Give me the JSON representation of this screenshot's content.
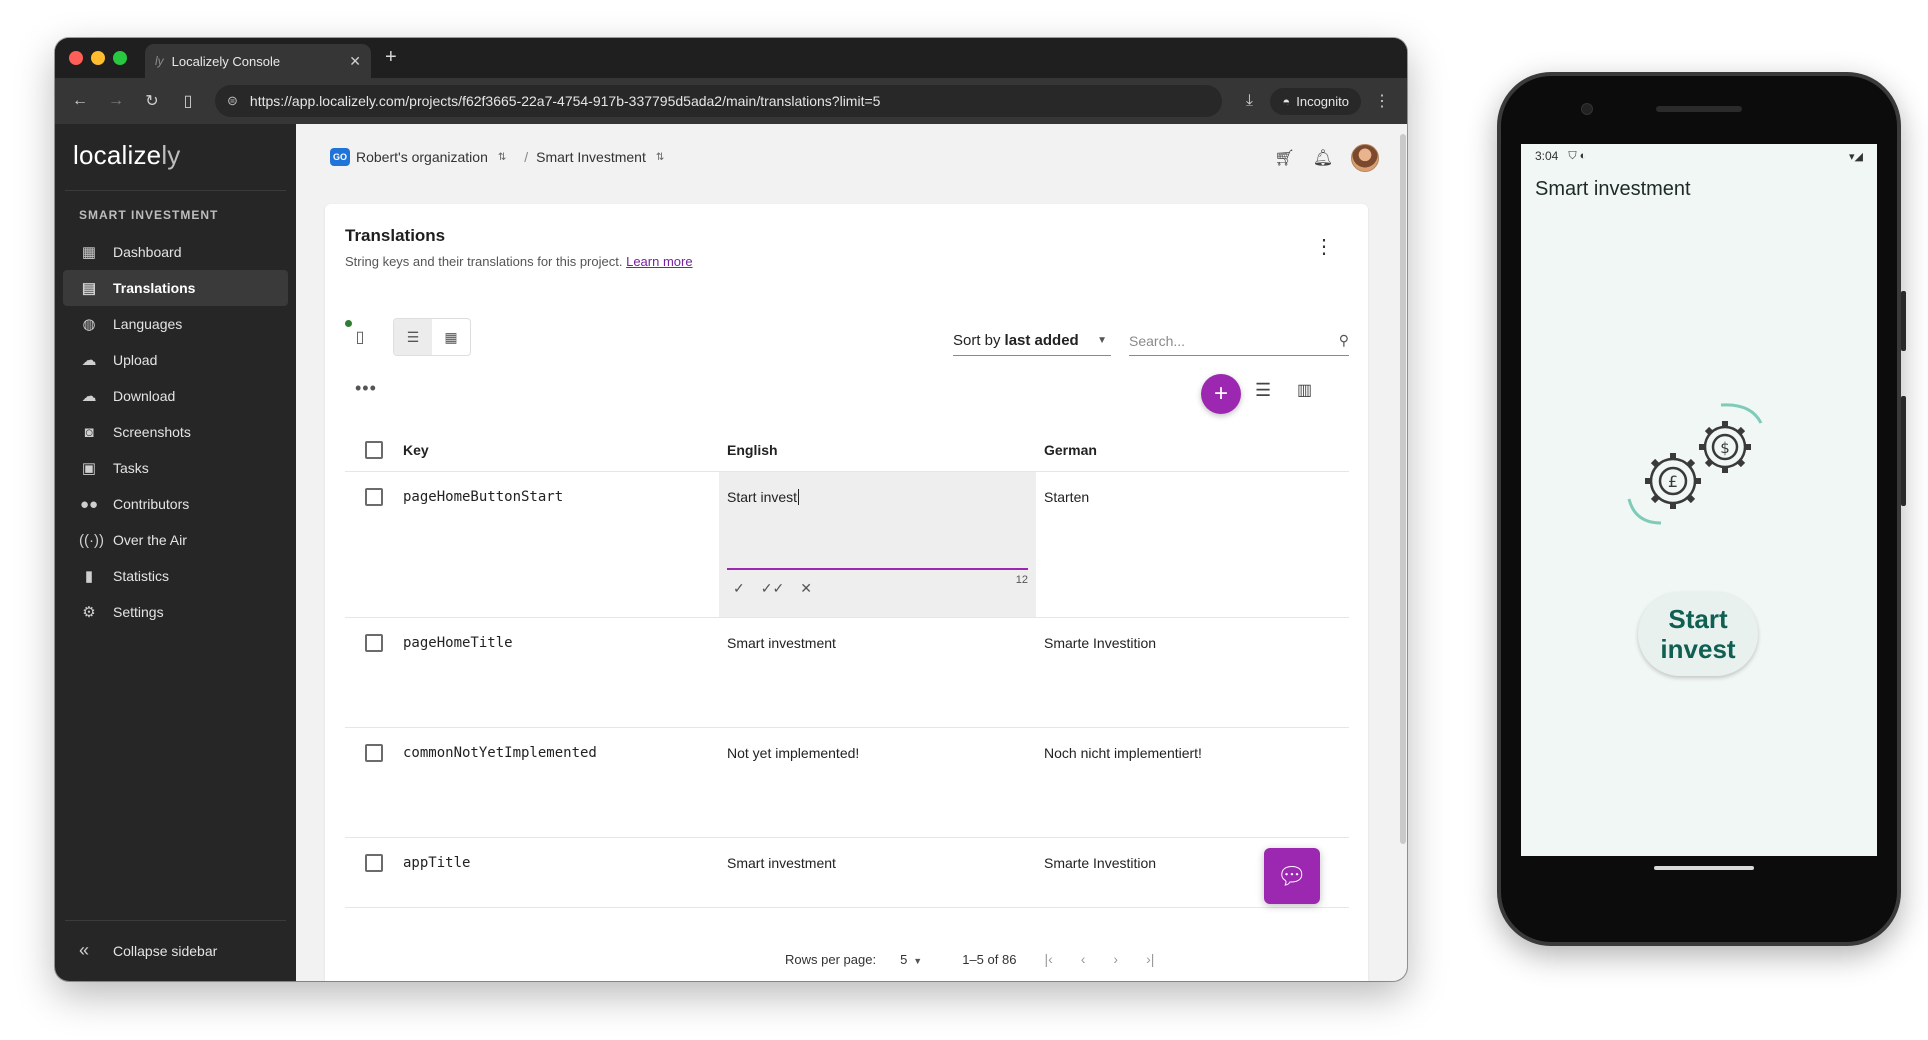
{
  "browser": {
    "tab_title": "Localizely Console",
    "tab_favicon": "ly",
    "url": "https://app.localizely.com/projects/f62f3665-22a7-4754-917b-337795d5ada2/main/translations?limit=5",
    "incognito_label": "Incognito"
  },
  "sidebar": {
    "logo_main": "localize",
    "logo_suffix": "ly",
    "project_name": "SMART INVESTMENT",
    "items": [
      {
        "label": "Dashboard",
        "icon": "dashboard-icon"
      },
      {
        "label": "Translations",
        "icon": "translations-icon",
        "active": true
      },
      {
        "label": "Languages",
        "icon": "globe-icon"
      },
      {
        "label": "Upload",
        "icon": "cloud-upload-icon"
      },
      {
        "label": "Download",
        "icon": "cloud-download-icon"
      },
      {
        "label": "Screenshots",
        "icon": "camera-icon"
      },
      {
        "label": "Tasks",
        "icon": "clipboard-icon"
      },
      {
        "label": "Contributors",
        "icon": "people-icon"
      },
      {
        "label": "Over the Air",
        "icon": "antenna-icon"
      },
      {
        "label": "Statistics",
        "icon": "bar-chart-icon"
      },
      {
        "label": "Settings",
        "icon": "gear-icon"
      }
    ],
    "collapse_label": "Collapse sidebar"
  },
  "header": {
    "org_badge": "GO",
    "org_name": "Robert's organization",
    "separator": "/",
    "project_name": "Smart Investment"
  },
  "card": {
    "title": "Translations",
    "subtitle": "String keys and their translations for this project.",
    "learn_more": "Learn more",
    "sort_prefix": "Sort by",
    "sort_value": "last added",
    "search_placeholder": "Search...",
    "more_label": "•••"
  },
  "table": {
    "columns": {
      "key": "Key",
      "en": "English",
      "de": "German"
    },
    "rows": [
      {
        "key": "pageHomeButtonStart",
        "en": "Start invest",
        "de": "Starten",
        "editing": true,
        "char_count": "12"
      },
      {
        "key": "pageHomeTitle",
        "en": "Smart investment",
        "de": "Smarte Investition"
      },
      {
        "key": "commonNotYetImplemented",
        "en": "Not yet implemented!",
        "de": "Noch nicht implementiert!"
      },
      {
        "key": "appTitle",
        "en": "Smart investment",
        "de": "Smarte Investition"
      }
    ]
  },
  "pagination": {
    "rows_per_page_label": "Rows per page:",
    "rows_per_page_value": "5",
    "range": "1–5 of 86"
  },
  "phone": {
    "time": "3:04",
    "app_title": "Smart investment",
    "button_line1": "Start",
    "button_line2": "invest"
  },
  "colors": {
    "accent": "#9c27b0",
    "sidebar_bg": "#262626",
    "phone_button_text": "#0f5f52"
  }
}
